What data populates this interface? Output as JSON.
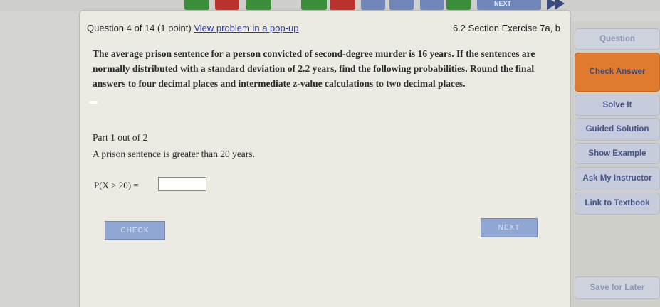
{
  "top_nav": {
    "next_label": "NEXT",
    "buttons": [
      {
        "color": "green"
      },
      {
        "color": "red"
      },
      {
        "color": "green"
      },
      {
        "color": "red"
      },
      {
        "color": "blue"
      },
      {
        "color": "blue"
      },
      {
        "color": "blue"
      },
      {
        "color": "green"
      },
      {
        "color": "blue"
      }
    ]
  },
  "question": {
    "header": "Question 4 of 14 (1 point)",
    "popup_link": "View problem in a pop-up",
    "section": "6.2 Section Exercise 7a, b",
    "problem_text": "The average prison sentence for a person convicted of second-degree murder is 16 years. If the sentences are normally distributed with a standard deviation of 2.2 years, find the following probabilities. Round the final answers to four decimal places and intermediate z-value calculations to two decimal places.",
    "part_label": "Part 1 out of 2",
    "part_text": "A prison sentence is greater than 20 years.",
    "answer_label": "P(X > 20) =",
    "answer_value": "",
    "check_label": "CHECK",
    "next_label": "NEXT"
  },
  "sidebar": {
    "question_label": "Question",
    "check_answer_label": "Check Answer",
    "solve_it_label": "Solve It",
    "guided_solution_label": "Guided Solution",
    "show_example_label": "Show Example",
    "ask_instructor_label": "Ask My Instructor",
    "link_textbook_label": "Link to Textbook",
    "save_later_label": "Save for Later"
  },
  "colors": {
    "accent_orange": "#e07a2e",
    "link_blue": "#2838a8",
    "button_blue": "#8fa7d2"
  }
}
